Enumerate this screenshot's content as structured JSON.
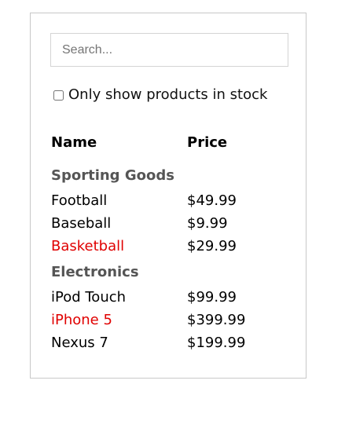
{
  "search": {
    "placeholder": "Search...",
    "value": ""
  },
  "stock_filter": {
    "label": "Only show products in stock",
    "checked": false
  },
  "table": {
    "headers": {
      "name": "Name",
      "price": "Price"
    },
    "categories": [
      {
        "name": "Sporting Goods",
        "products": [
          {
            "name": "Football",
            "price": "$49.99",
            "in_stock": true
          },
          {
            "name": "Baseball",
            "price": "$9.99",
            "in_stock": true
          },
          {
            "name": "Basketball",
            "price": "$29.99",
            "in_stock": false
          }
        ]
      },
      {
        "name": "Electronics",
        "products": [
          {
            "name": "iPod Touch",
            "price": "$99.99",
            "in_stock": true
          },
          {
            "name": "iPhone 5",
            "price": "$399.99",
            "in_stock": false
          },
          {
            "name": "Nexus 7",
            "price": "$199.99",
            "in_stock": true
          }
        ]
      }
    ]
  },
  "colors": {
    "out_of_stock": "#e00000",
    "category": "#555555",
    "border": "#c8c8c8"
  }
}
